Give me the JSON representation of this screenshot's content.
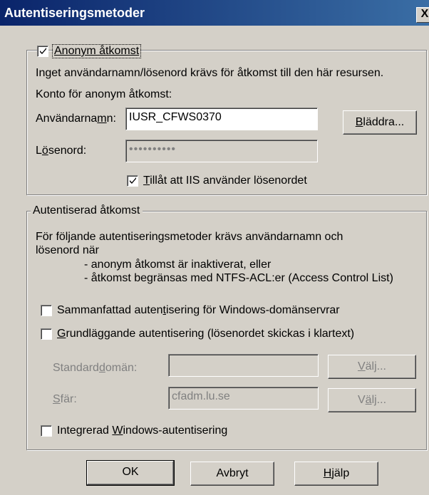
{
  "window": {
    "title": "Autentiseringsmetoder",
    "close_glyph": "X"
  },
  "anon": {
    "checkbox_label_pre": "",
    "checkbox_label": "Anonym åtkomst",
    "checked": true,
    "description": "Inget användarnamn/lösenord krävs för åtkomst till den här resursen.",
    "account_heading": "Konto för anonym åtkomst:",
    "username_label_pre": "Användarna",
    "username_label_ul": "m",
    "username_label_post": "n:",
    "username_value": "IUSR_CFWS0370",
    "browse_label_ul": "B",
    "browse_label_post": "läddra...",
    "password_label_pre": "L",
    "password_label_ul": "ö",
    "password_label_post": "senord:",
    "password_value": "••••••••••",
    "allow_iis_checked": true,
    "allow_iis_ul": "T",
    "allow_iis_post": "illåt att IIS använder lösenordet"
  },
  "auth": {
    "legend": "Autentiserad åtkomst",
    "desc_line1": "För följande autentiseringsmetoder krävs användarnamn och",
    "desc_line2": "lösenord när",
    "bullet1": "- anonym åtkomst är inaktiverat, eller",
    "bullet2": "- åtkomst begränsas med NTFS-ACL:er (Access Control List)",
    "digest_pre": "Sammanfattad auten",
    "digest_ul": "t",
    "digest_post": "isering för Windows-domänservrar",
    "digest_checked": false,
    "basic_ul": "G",
    "basic_post": "rundläggande autentisering (lösenordet skickas i klartext)",
    "basic_checked": false,
    "domain_label_pre": "Standard",
    "domain_label_ul": "d",
    "domain_label_post": "omän:",
    "domain_value": "",
    "domain_select_ul": "V",
    "domain_select_post": "älj...",
    "realm_label_ul": "S",
    "realm_label_post": "fär:",
    "realm_value": "cfadm.lu.se",
    "realm_select_pre": "V",
    "realm_select_ul": "ä",
    "realm_select_post": "lj...",
    "integrated_pre": "Integrerad ",
    "integrated_ul": "W",
    "integrated_post": "indows-autentisering",
    "integrated_checked": false
  },
  "buttons": {
    "ok": "OK",
    "cancel": "Avbryt",
    "help_ul": "H",
    "help_post": "jälp"
  }
}
